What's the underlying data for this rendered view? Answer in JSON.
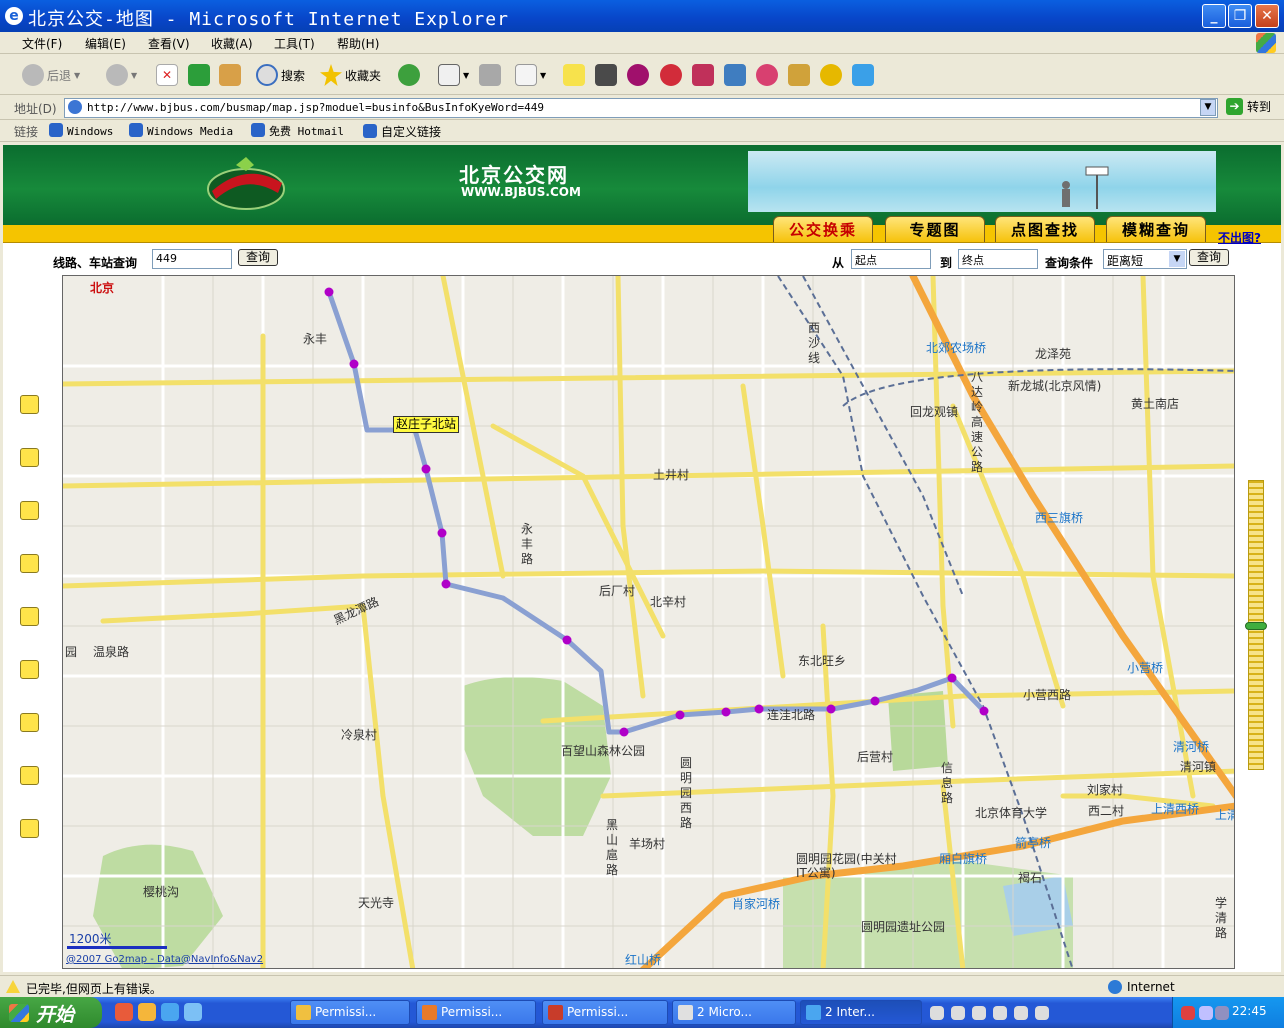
{
  "window": {
    "title": "北京公交-地图 - Microsoft Internet Explorer"
  },
  "menu": [
    "文件(F)",
    "编辑(E)",
    "查看(V)",
    "收藏(A)",
    "工具(T)",
    "帮助(H)"
  ],
  "toolbar": {
    "back": "后退",
    "search": "搜索",
    "favorites": "收藏夹"
  },
  "address": {
    "label": "地址(D)",
    "url": "http://www.bjbus.com/busmap/map.jsp?moduel=businfo&BusInfoKyeWord=449",
    "go": "转到"
  },
  "links": {
    "label": "链接",
    "items": [
      "Windows",
      "Windows Media",
      "免费 Hotmail",
      "自定义链接"
    ]
  },
  "site": {
    "name": "北京公交网",
    "url": "WWW.BJBUS.COM",
    "tabs": [
      "公交换乘",
      "专题图",
      "点图查找",
      "模糊查询"
    ],
    "not_shown_link": "不出图?"
  },
  "search": {
    "line_label": "线路、车站查询",
    "line_value": "449",
    "query_btn": "查询",
    "from_label": "从",
    "from_value": "起点",
    "to_label": "到",
    "to_value": "终点",
    "cond_label": "查询条件",
    "cond_value": "距离短"
  },
  "map": {
    "city": "北京",
    "stop_callout": "赵庄子北站",
    "scale": "1200米",
    "copyright": "@2007 Go2map - Data@NavInfo&Nav2",
    "route_color": "#8aa0d2",
    "stop_color": "#b000c8",
    "labels": {
      "yongfeng": "永丰",
      "yongfeng_road": "永丰路",
      "shangzhuangcun": "土井村",
      "houchangcun": "后厂村",
      "beixincun": "北辛村",
      "dongbeiwang": "东北旺乡",
      "lianwa_road": "连洼北路",
      "houyingcun": "后营村",
      "xinxi_road": "信息路",
      "beitiyu": "北京体育大学",
      "qinghe_bridge": "清河桥",
      "qinghezhen": "清河镇",
      "xiaoying_bridge": "小营桥",
      "xiaoying_xilu": "小营西路",
      "xisanqi_bridge": "西三旗桥",
      "huilongguan": "回龙观镇",
      "xinlongcheng": "新龙城(北京风情)",
      "huangtu": "黄土南店",
      "longzeyuan": "龙泽苑",
      "beijiao_bridge": "北郊农场桥",
      "badaling": "八达岭高速公路",
      "xisha_line": "西沙线",
      "heilongtan_road": "黑龙潭路",
      "wenquan_road": "温泉路",
      "yuan": "园",
      "lengquancun": "冷泉村",
      "baiwangshan": "百望山森林公园",
      "yuanmingyuan_west": "圆明园西路",
      "heishanhu": "黑山扈路",
      "yangfangcun": "羊场村",
      "yuanmingyuan_huayuan": "圆明园花园(中关村IT公寓)",
      "xiaojiahe": "肖家河桥",
      "yuanmingyuan_ruins": "圆明园遗址公园",
      "yingtaogou": "樱桃沟",
      "tianguangsi": "天光寺",
      "hongshan_bridge": "红山桥",
      "liujiacun": "刘家村",
      "xierqi": "西二村",
      "shangqing_bridge": "上清西桥",
      "shangqing": "上清",
      "jianxiang_bridge": "箭亭桥",
      "xiangbaiqi": "厢白旗桥",
      "xueqing_road": "学清路",
      "heshi": "褐石"
    }
  },
  "status": {
    "text": "已完毕,但网页上有错误。",
    "zone": "Internet"
  },
  "taskbar": {
    "start": "开始",
    "tasks": [
      "Permissi...",
      "Permissi...",
      "Permissi...",
      "2 Micro...",
      "2 Inter..."
    ],
    "clock": "22:45"
  }
}
